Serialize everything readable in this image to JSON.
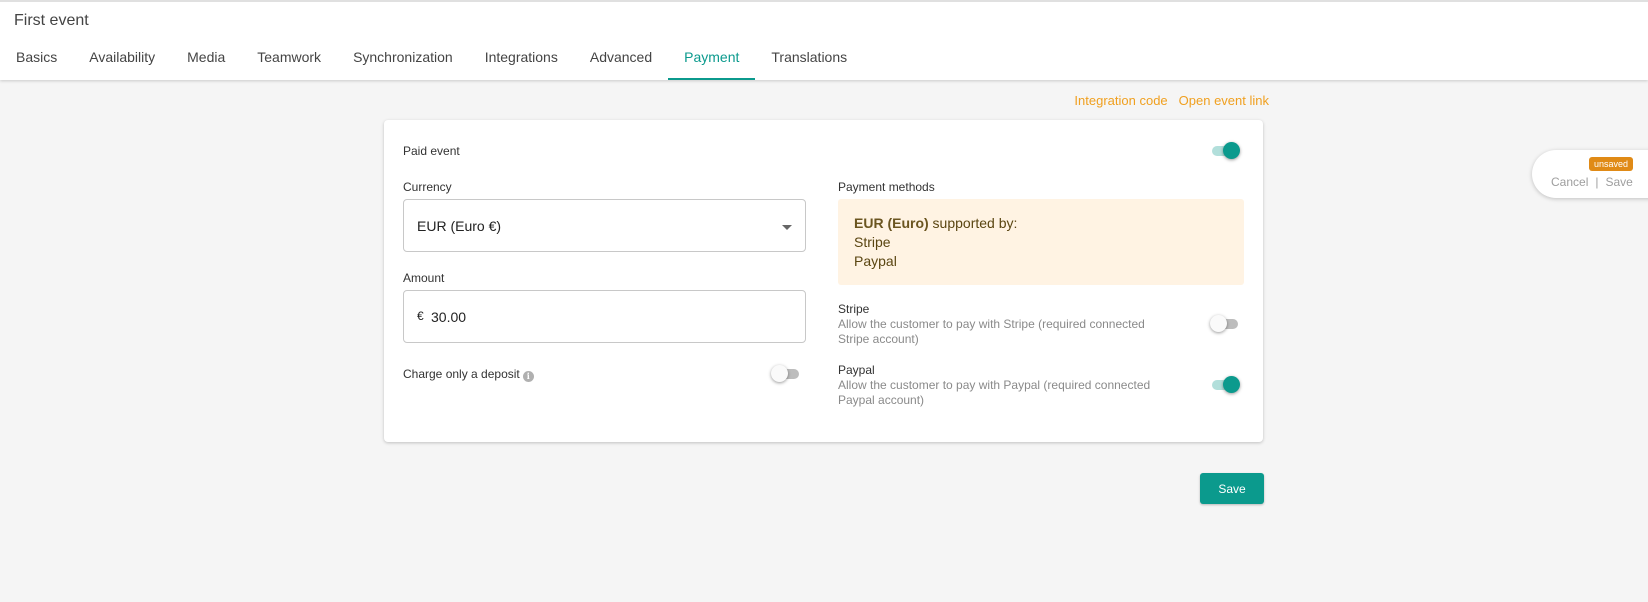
{
  "header": {
    "title": "First event",
    "tabs": [
      {
        "label": "Basics"
      },
      {
        "label": "Availability"
      },
      {
        "label": "Media"
      },
      {
        "label": "Teamwork"
      },
      {
        "label": "Synchronization"
      },
      {
        "label": "Integrations"
      },
      {
        "label": "Advanced"
      },
      {
        "label": "Payment",
        "active": true
      },
      {
        "label": "Translations"
      }
    ]
  },
  "links": {
    "integration_code": "Integration code",
    "open_event_link": "Open event link"
  },
  "form": {
    "paid_event": {
      "label": "Paid event",
      "enabled": true
    },
    "currency": {
      "label": "Currency",
      "value": "EUR (Euro €)"
    },
    "amount": {
      "label": "Amount",
      "prefix": "€",
      "value": "30.00"
    },
    "deposit": {
      "label": "Charge only a deposit",
      "enabled": false
    },
    "payment_methods": {
      "label": "Payment methods",
      "support_currency": "EUR (Euro)",
      "support_text": " supported by:",
      "supported": [
        "Stripe",
        "Paypal"
      ]
    },
    "stripe": {
      "title": "Stripe",
      "description": "Allow the customer to pay with Stripe (required connected Stripe account)",
      "enabled": false
    },
    "paypal": {
      "title": "Paypal",
      "description": "Allow the customer to pay with Paypal (required connected Paypal account)",
      "enabled": true
    }
  },
  "save_label": "Save",
  "floating": {
    "badge": "unsaved",
    "cancel": "Cancel",
    "separator": "|",
    "save": "Save"
  },
  "colors": {
    "accent": "#0b9a8d",
    "link": "#f0a020",
    "badge": "#e08a16",
    "support_bg": "#fff3e3"
  }
}
